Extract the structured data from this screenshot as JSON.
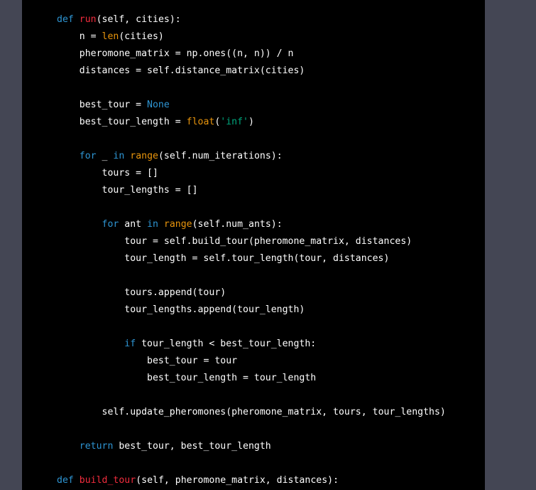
{
  "colors": {
    "page_background": "#444654",
    "code_background": "#000000",
    "plain": "#ffffff",
    "keyword": "#2e95d3",
    "function_name": "#f22c3d",
    "builtin": "#e9950c",
    "string": "#00a67d"
  },
  "code": {
    "language": "python",
    "lines": [
      {
        "indent": "",
        "tokens": [
          {
            "t": "def",
            "c": "kw"
          },
          {
            "t": " ",
            "c": "plain"
          },
          {
            "t": "run",
            "c": "fn"
          },
          {
            "t": "(self, cities):",
            "c": "plain"
          }
        ]
      },
      {
        "indent": "    ",
        "tokens": [
          {
            "t": "n = ",
            "c": "plain"
          },
          {
            "t": "len",
            "c": "bi"
          },
          {
            "t": "(cities)",
            "c": "plain"
          }
        ]
      },
      {
        "indent": "    ",
        "tokens": [
          {
            "t": "pheromone_matrix = np.ones((n, n)) / n",
            "c": "plain"
          }
        ]
      },
      {
        "indent": "    ",
        "tokens": [
          {
            "t": "distances = self.distance_matrix(cities)",
            "c": "plain"
          }
        ]
      },
      {
        "indent": "",
        "tokens": []
      },
      {
        "indent": "    ",
        "tokens": [
          {
            "t": "best_tour = ",
            "c": "plain"
          },
          {
            "t": "None",
            "c": "kw"
          }
        ]
      },
      {
        "indent": "    ",
        "tokens": [
          {
            "t": "best_tour_length = ",
            "c": "plain"
          },
          {
            "t": "float",
            "c": "bi"
          },
          {
            "t": "(",
            "c": "plain"
          },
          {
            "t": "'inf'",
            "c": "str"
          },
          {
            "t": ")",
            "c": "plain"
          }
        ]
      },
      {
        "indent": "",
        "tokens": []
      },
      {
        "indent": "    ",
        "tokens": [
          {
            "t": "for",
            "c": "kw"
          },
          {
            "t": " _ ",
            "c": "plain"
          },
          {
            "t": "in",
            "c": "kw"
          },
          {
            "t": " ",
            "c": "plain"
          },
          {
            "t": "range",
            "c": "bi"
          },
          {
            "t": "(self.num_iterations):",
            "c": "plain"
          }
        ]
      },
      {
        "indent": "        ",
        "tokens": [
          {
            "t": "tours = []",
            "c": "plain"
          }
        ]
      },
      {
        "indent": "        ",
        "tokens": [
          {
            "t": "tour_lengths = []",
            "c": "plain"
          }
        ]
      },
      {
        "indent": "",
        "tokens": []
      },
      {
        "indent": "        ",
        "tokens": [
          {
            "t": "for",
            "c": "kw"
          },
          {
            "t": " ant ",
            "c": "plain"
          },
          {
            "t": "in",
            "c": "kw"
          },
          {
            "t": " ",
            "c": "plain"
          },
          {
            "t": "range",
            "c": "bi"
          },
          {
            "t": "(self.num_ants):",
            "c": "plain"
          }
        ]
      },
      {
        "indent": "            ",
        "tokens": [
          {
            "t": "tour = self.build_tour(pheromone_matrix, distances)",
            "c": "plain"
          }
        ]
      },
      {
        "indent": "            ",
        "tokens": [
          {
            "t": "tour_length = self.tour_length(tour, distances)",
            "c": "plain"
          }
        ]
      },
      {
        "indent": "",
        "tokens": []
      },
      {
        "indent": "            ",
        "tokens": [
          {
            "t": "tours.append(tour)",
            "c": "plain"
          }
        ]
      },
      {
        "indent": "            ",
        "tokens": [
          {
            "t": "tour_lengths.append(tour_length)",
            "c": "plain"
          }
        ]
      },
      {
        "indent": "",
        "tokens": []
      },
      {
        "indent": "            ",
        "tokens": [
          {
            "t": "if",
            "c": "kw"
          },
          {
            "t": " tour_length < best_tour_length:",
            "c": "plain"
          }
        ]
      },
      {
        "indent": "                ",
        "tokens": [
          {
            "t": "best_tour = tour",
            "c": "plain"
          }
        ]
      },
      {
        "indent": "                ",
        "tokens": [
          {
            "t": "best_tour_length = tour_length",
            "c": "plain"
          }
        ]
      },
      {
        "indent": "",
        "tokens": []
      },
      {
        "indent": "        ",
        "tokens": [
          {
            "t": "self.update_pheromones(pheromone_matrix, tours, tour_lengths)",
            "c": "plain"
          }
        ]
      },
      {
        "indent": "",
        "tokens": []
      },
      {
        "indent": "    ",
        "tokens": [
          {
            "t": "return",
            "c": "kw"
          },
          {
            "t": " best_tour, best_tour_length",
            "c": "plain"
          }
        ]
      },
      {
        "indent": "",
        "tokens": []
      },
      {
        "indent": "",
        "tokens": [
          {
            "t": "def",
            "c": "kw"
          },
          {
            "t": " ",
            "c": "plain"
          },
          {
            "t": "build_tour",
            "c": "fn"
          },
          {
            "t": "(self, pheromone_matrix, distances):",
            "c": "plain"
          }
        ]
      }
    ]
  }
}
